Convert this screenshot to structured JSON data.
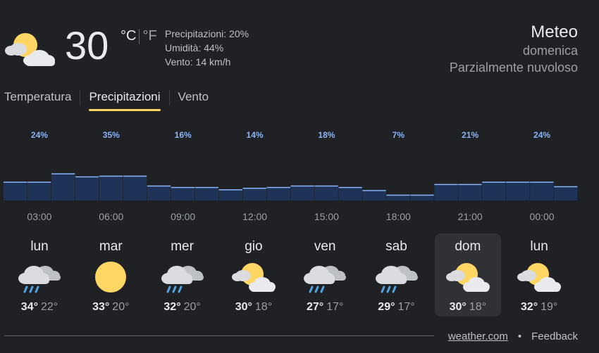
{
  "current": {
    "icon": "partly-cloudy-icon",
    "temperature": "30",
    "unit_c": "°C",
    "unit_f": "°F",
    "precipitation": "Precipitazioni: 20%",
    "humidity": "Umidità: 44%",
    "wind": "Vento: 14 km/h"
  },
  "header": {
    "title": "Meteo",
    "day": "domenica",
    "condition": "Parzialmente nuvoloso"
  },
  "tabs": [
    {
      "label": "Temperatura",
      "active": false
    },
    {
      "label": "Precipitazioni",
      "active": true
    },
    {
      "label": "Vento",
      "active": false
    }
  ],
  "colors": {
    "background": "#202124",
    "bar_fill": "#1f3358",
    "bar_top": "#8ab4f8",
    "label_blue": "#8ab4f8",
    "active_tab": "#fdd663"
  },
  "chart_data": {
    "type": "bar",
    "title": "",
    "labeled_values": [
      "24%",
      "35%",
      "16%",
      "14%",
      "18%",
      "7%",
      "21%",
      "24%"
    ],
    "time_labels": [
      "03:00",
      "06:00",
      "09:00",
      "12:00",
      "15:00",
      "18:00",
      "21:00",
      "00:00"
    ],
    "values": [
      24,
      24,
      35,
      31,
      32,
      32,
      19,
      17,
      17,
      14,
      16,
      17,
      19,
      19,
      17,
      13,
      7,
      7,
      21,
      21,
      24,
      24,
      24,
      18
    ],
    "ylim": [
      0,
      100
    ]
  },
  "days": [
    {
      "name": "lun",
      "icon": "rain-cloud-icon",
      "hi": "34°",
      "lo": "22°",
      "selected": false
    },
    {
      "name": "mar",
      "icon": "sun-icon",
      "hi": "33°",
      "lo": "20°",
      "selected": false
    },
    {
      "name": "mer",
      "icon": "rain-cloud-icon",
      "hi": "32°",
      "lo": "20°",
      "selected": false
    },
    {
      "name": "gio",
      "icon": "partly-cloudy-icon",
      "hi": "30°",
      "lo": "18°",
      "selected": false
    },
    {
      "name": "ven",
      "icon": "rain-cloud-icon",
      "hi": "27°",
      "lo": "17°",
      "selected": false
    },
    {
      "name": "sab",
      "icon": "rain-cloud-icon",
      "hi": "29°",
      "lo": "17°",
      "selected": false
    },
    {
      "name": "dom",
      "icon": "partly-cloudy-icon",
      "hi": "30°",
      "lo": "18°",
      "selected": true
    },
    {
      "name": "lun",
      "icon": "partly-cloudy-icon",
      "hi": "32°",
      "lo": "19°",
      "selected": false
    }
  ],
  "footer": {
    "source": "weather.com",
    "separator": "•",
    "feedback": "Feedback"
  }
}
